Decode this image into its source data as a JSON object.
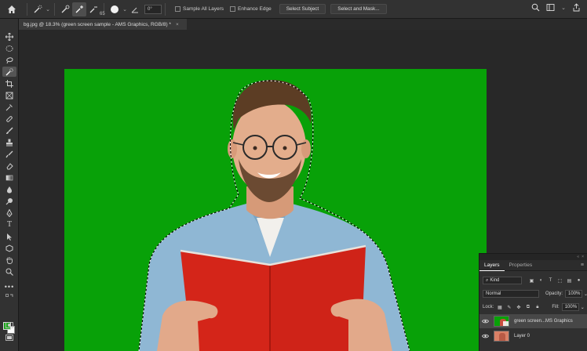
{
  "options_bar": {
    "brush_size": "65",
    "angle": "0°",
    "sample_all_layers": "Sample All Layers",
    "enhance_edge": "Enhance Edge",
    "select_subject": "Select Subject",
    "select_and_mask": "Select and Mask..."
  },
  "document": {
    "tab_title": "bg.jpg @ 18.3% (green screen sample - AMS Graphics, RGB/8) *",
    "tab_close": "×"
  },
  "colors": {
    "foreground": "#1ea41e",
    "background": "#ffffff",
    "canvas_green": "#08a108",
    "book_red": "#d42519"
  },
  "layers_panel": {
    "tabs": [
      "Layers",
      "Properties"
    ],
    "filter_kind": "Kind",
    "blend_mode": "Normal",
    "opacity_label": "Opacity:",
    "opacity_value": "100%",
    "lock_label": "Lock:",
    "fill_label": "Fill:",
    "fill_value": "100%",
    "layers": [
      {
        "name": "green screen...MS Graphics",
        "selected": true
      },
      {
        "name": "Layer 0",
        "selected": false
      }
    ]
  }
}
